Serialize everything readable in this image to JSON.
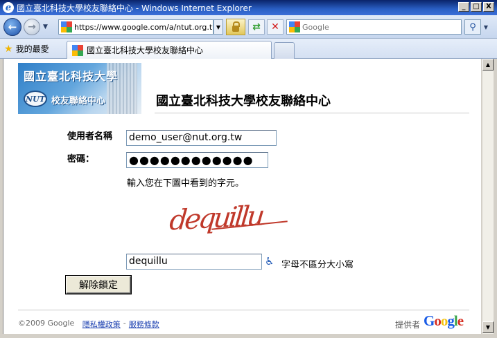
{
  "window": {
    "title": "國立臺北科技大學校友聯絡中心 - Windows Internet Explorer",
    "minimize": "_",
    "maximize": "□",
    "close": "X"
  },
  "navbar": {
    "address_url": "https://www.google.com/a/ntut.org.tw/Unk",
    "search_placeholder": "Google"
  },
  "tabs": {
    "favorites_label": "我的最愛",
    "active_tab_label": "國立臺北科技大學校友聯絡中心"
  },
  "page": {
    "banner_line1": "國立臺北科技大學",
    "banner_line2": "校友聯絡中心",
    "heading": "國立臺北科技大學校友聯絡中心",
    "username_label": "使用者名稱",
    "username_value": "demo_user@nut.org.tw",
    "password_label": "密碼：",
    "password_value": "●●●●●●●●●●●●",
    "captcha_hint": "輸入您在下圖中看到的字元。",
    "captcha_word": "dequillu",
    "captcha_input_value": "dequillu",
    "case_note": "字母不區分大小寫",
    "unlock_button": "解除鎖定"
  },
  "footer": {
    "copyright": "©2009 Google",
    "privacy_link": "隱私權政策",
    "separator": "-",
    "terms_link": "服務條款",
    "provided_by": "提供者",
    "google_logo": "Google"
  },
  "colors": {
    "link": "#1a3fb0",
    "captcha": "#c0392b",
    "titlebar": "#0a246a"
  }
}
